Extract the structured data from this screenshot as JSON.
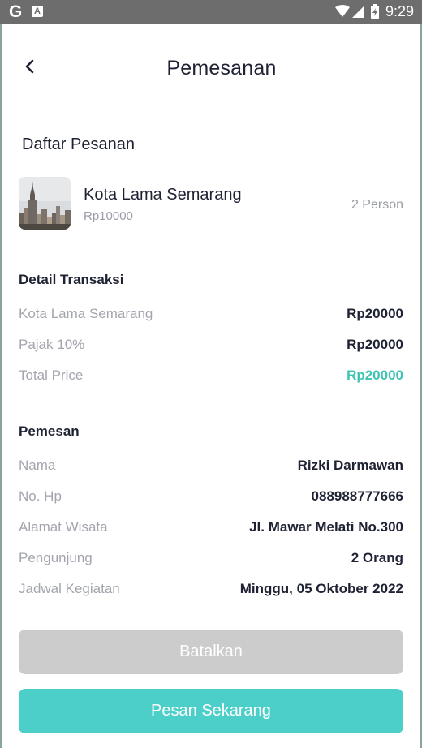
{
  "status_bar": {
    "g_label": "G",
    "a_label": "A",
    "time": "9:29"
  },
  "header": {
    "title": "Pemesanan",
    "back_icon": "chevron-left-icon"
  },
  "order_list": {
    "title": "Daftar Pesanan",
    "item": {
      "name": "Kota Lama Semarang",
      "price": "Rp10000",
      "quantity": "2 Person"
    }
  },
  "transaction": {
    "title": "Detail Transaksi",
    "rows": [
      {
        "label": "Kota Lama Semarang",
        "value": "Rp20000"
      },
      {
        "label": "Pajak 10%",
        "value": "Rp20000"
      },
      {
        "label": "Total Price",
        "value": "Rp20000"
      }
    ]
  },
  "customer": {
    "title": "Pemesan",
    "rows": [
      {
        "label": "Nama",
        "value": "Rizki Darmawan"
      },
      {
        "label": "No. Hp",
        "value": "088988777666"
      },
      {
        "label": "Alamat Wisata",
        "value": "Jl. Mawar Melati No.300"
      },
      {
        "label": "Pengunjung",
        "value": "2 Orang"
      },
      {
        "label": "Jadwal Kegiatan",
        "value": "Minggu, 05 Oktober 2022"
      }
    ]
  },
  "actions": {
    "cancel_label": "Batalkan",
    "order_label": "Pesan Sekarang"
  },
  "colors": {
    "accent": "#3fc3b3",
    "order_button": "#4ccfc9",
    "cancel_button": "#cccccc",
    "status_bar": "#6d6d6d"
  }
}
